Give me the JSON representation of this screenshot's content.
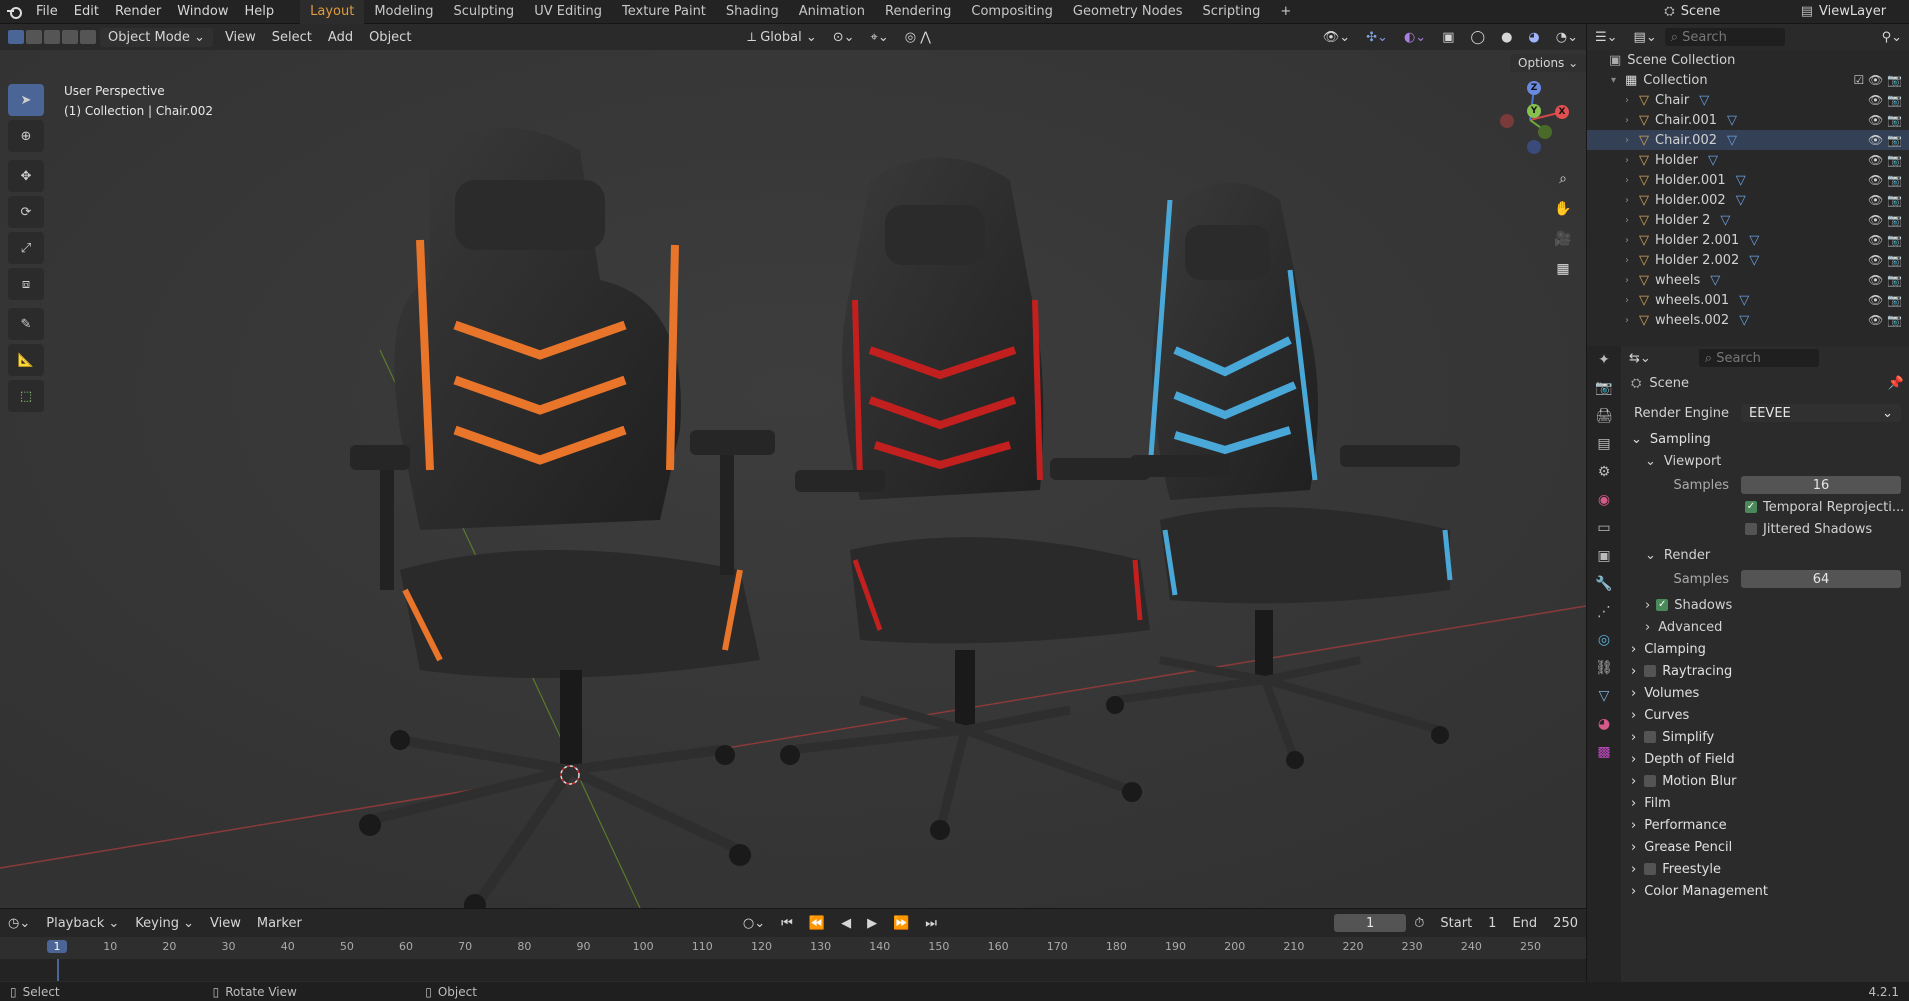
{
  "topbar": {
    "menus": [
      "File",
      "Edit",
      "Render",
      "Window",
      "Help"
    ],
    "workspaces": [
      "Layout",
      "Modeling",
      "Sculpting",
      "UV Editing",
      "Texture Paint",
      "Shading",
      "Animation",
      "Rendering",
      "Compositing",
      "Geometry Nodes",
      "Scripting"
    ],
    "add_tab": "+",
    "scene": "Scene",
    "viewlayer": "ViewLayer"
  },
  "header": {
    "mode": "Object Mode",
    "menus": [
      "View",
      "Select",
      "Add",
      "Object"
    ],
    "transform": "Global",
    "options": "Options"
  },
  "viewport": {
    "perspective": "User Perspective",
    "context": "(1) Collection | Chair.002"
  },
  "gizmo": {
    "x": "X",
    "y": "Y",
    "z": "Z"
  },
  "outliner": {
    "search_placeholder": "Search",
    "root": "Scene Collection",
    "collection": "Collection",
    "items": [
      "Chair",
      "Chair.001",
      "Chair.002",
      "Holder",
      "Holder.001",
      "Holder.002",
      "Holder 2",
      "Holder 2.001",
      "Holder 2.002",
      "wheels",
      "wheels.001",
      "wheels.002"
    ]
  },
  "properties": {
    "search_placeholder": "Search",
    "context": "Scene",
    "render_engine_label": "Render Engine",
    "render_engine": "EEVEE",
    "sampling": "Sampling",
    "viewport": "Viewport",
    "samples_label": "Samples",
    "viewport_samples": "16",
    "temporal": "Temporal Reprojecti...",
    "jittered": "Jittered Shadows",
    "render": "Render",
    "render_samples": "64",
    "shadows": "Shadows",
    "advanced": "Advanced",
    "sections": [
      "Clamping",
      "Raytracing",
      "Volumes",
      "Curves",
      "Simplify",
      "Depth of Field",
      "Motion Blur",
      "Film",
      "Performance",
      "Grease Pencil",
      "Freestyle",
      "Color Management"
    ]
  },
  "timeline": {
    "menus": [
      "Playback",
      "Keying",
      "View",
      "Marker"
    ],
    "current_frame": "1",
    "start_label": "Start",
    "start": "1",
    "end_label": "End",
    "end": "250",
    "ticks": [
      "1",
      "10",
      "20",
      "30",
      "40",
      "50",
      "60",
      "70",
      "80",
      "90",
      "100",
      "110",
      "120",
      "130",
      "140",
      "150",
      "160",
      "170",
      "180",
      "190",
      "200",
      "210",
      "220",
      "230",
      "240",
      "250"
    ]
  },
  "statusbar": {
    "select": "Select",
    "rotate": "Rotate View",
    "object": "Object",
    "version": "4.2.1"
  },
  "colors": {
    "accent": "#e09a3e",
    "active_tool": "#4a6596",
    "chair_orange": "#e8752a",
    "chair_red": "#c21f1f",
    "chair_blue": "#4aa8d8"
  }
}
